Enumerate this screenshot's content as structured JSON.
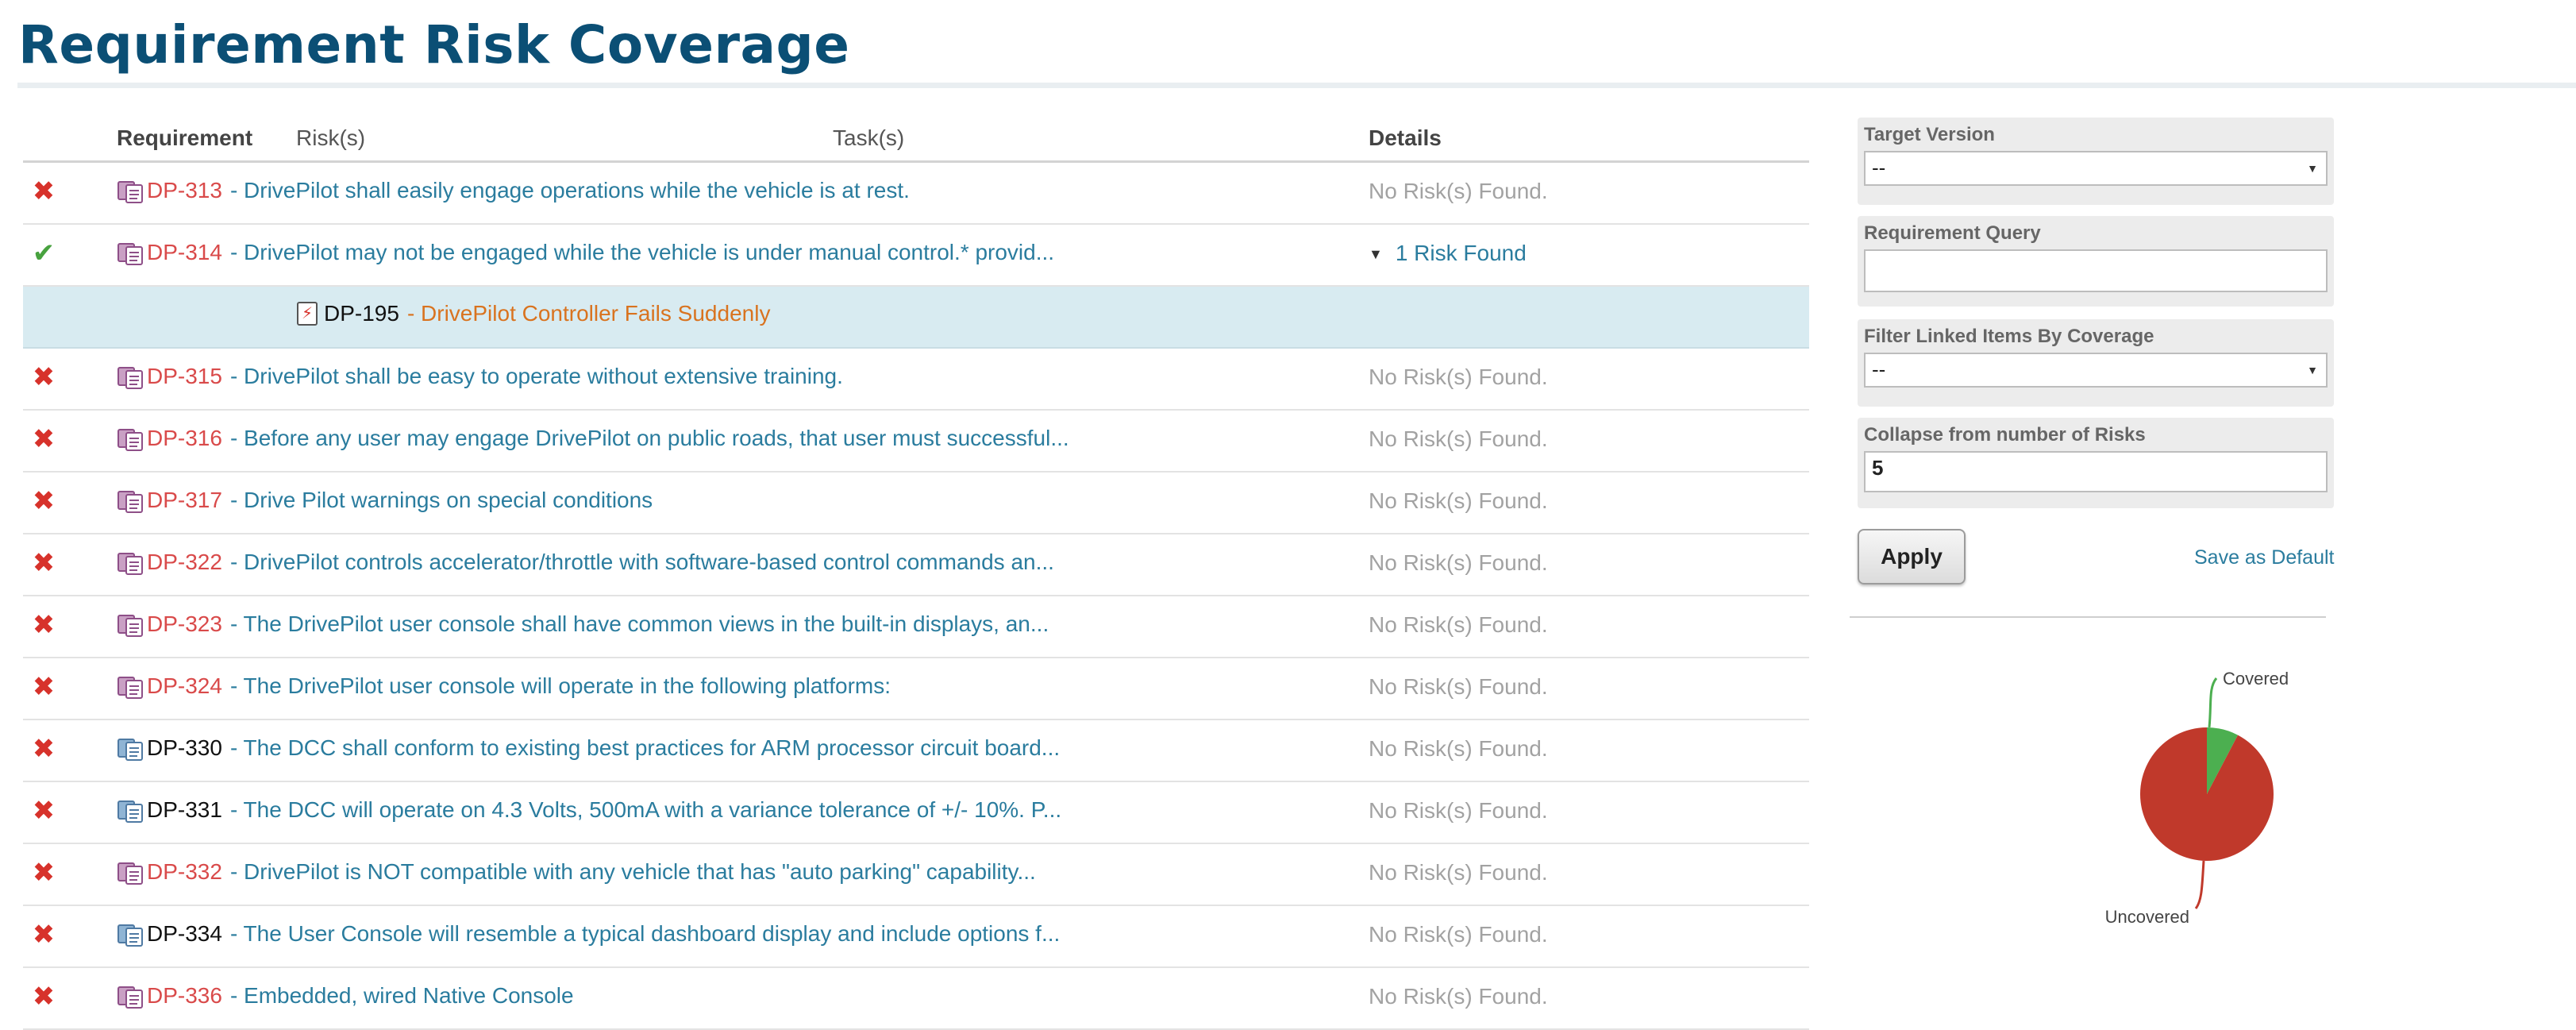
{
  "page": {
    "title": "Requirement Risk Coverage"
  },
  "table": {
    "headers": {
      "requirement": "Requirement",
      "risks": "Risk(s)",
      "tasks": "Task(s)",
      "details": "Details"
    },
    "rows": [
      {
        "status": "uncovered",
        "icon": "pink",
        "id": "DP-313",
        "text": "- DrivePilot shall easily engage operations while the vehicle is at rest.",
        "details": "No Risk(s) Found."
      },
      {
        "status": "covered",
        "icon": "pink",
        "id": "DP-314",
        "text": "- DrivePilot may not be engaged while the vehicle is under manual control.* provid...",
        "details": "1 Risk Found"
      },
      {
        "status": "uncovered",
        "icon": "pink",
        "id": "DP-315",
        "text": "- DrivePilot shall be easy to operate without extensive training.",
        "details": "No Risk(s) Found."
      },
      {
        "status": "uncovered",
        "icon": "pink",
        "id": "DP-316",
        "text": "- Before any user may engage DrivePilot on public roads, that user must successful...",
        "details": "No Risk(s) Found."
      },
      {
        "status": "uncovered",
        "icon": "pink",
        "id": "DP-317",
        "text": "- Drive Pilot warnings on special conditions",
        "details": "No Risk(s) Found."
      },
      {
        "status": "uncovered",
        "icon": "pink",
        "id": "DP-322",
        "text": "- DrivePilot controls accelerator/throttle with software-based control commands an...",
        "details": "No Risk(s) Found."
      },
      {
        "status": "uncovered",
        "icon": "pink",
        "id": "DP-323",
        "text": "- The DrivePilot user console shall have common views in the built-in displays, an...",
        "details": "No Risk(s) Found."
      },
      {
        "status": "uncovered",
        "icon": "pink",
        "id": "DP-324",
        "text": "- The DrivePilot user console will operate in the following platforms:",
        "details": "No Risk(s) Found."
      },
      {
        "status": "uncovered",
        "icon": "blue",
        "id": "DP-330",
        "text": "- The DCC shall conform to existing best practices for ARM processor circuit board...",
        "details": "No Risk(s) Found."
      },
      {
        "status": "uncovered",
        "icon": "blue",
        "id": "DP-331",
        "text": "- The DCC will operate on 4.3 Volts, 500mA with a variance tolerance of +/- 10%. P...",
        "details": "No Risk(s) Found."
      },
      {
        "status": "uncovered",
        "icon": "pink",
        "id": "DP-332",
        "text": "- DrivePilot is NOT compatible with any vehicle that has \"auto parking\" capability...",
        "details": "No Risk(s) Found."
      },
      {
        "status": "uncovered",
        "icon": "blue",
        "id": "DP-334",
        "text": "- The User Console will resemble a typical dashboard display and include options f...",
        "details": "No Risk(s) Found."
      },
      {
        "status": "uncovered",
        "icon": "pink",
        "id": "DP-336",
        "text": "- Embedded, wired Native Console",
        "details": "No Risk(s) Found."
      }
    ],
    "expanded_risk": {
      "id": "DP-195",
      "text": "- DrivePilot Controller Fails Suddenly"
    }
  },
  "filters": {
    "target_version": {
      "label": "Target Version",
      "value": "--"
    },
    "requirement_query": {
      "label": "Requirement Query",
      "value": ""
    },
    "filter_linked": {
      "label": "Filter Linked Items By Coverage",
      "value": "--"
    },
    "collapse_from": {
      "label": "Collapse from number of Risks",
      "value": "5"
    },
    "apply_label": "Apply",
    "save_default_label": "Save as Default"
  },
  "chart_data": {
    "type": "pie",
    "title": "",
    "slices": [
      {
        "label": "Covered",
        "value": 1,
        "color": "#4caf50"
      },
      {
        "label": "Uncovered",
        "value": 12,
        "color": "#c0392b"
      }
    ]
  },
  "colors": {
    "title": "#0b4f75",
    "link": "#2a7c9e",
    "req_id": "#d94a4a",
    "risk_text": "#d9731f",
    "uncovered": "#c0392b",
    "covered": "#4caf50"
  }
}
